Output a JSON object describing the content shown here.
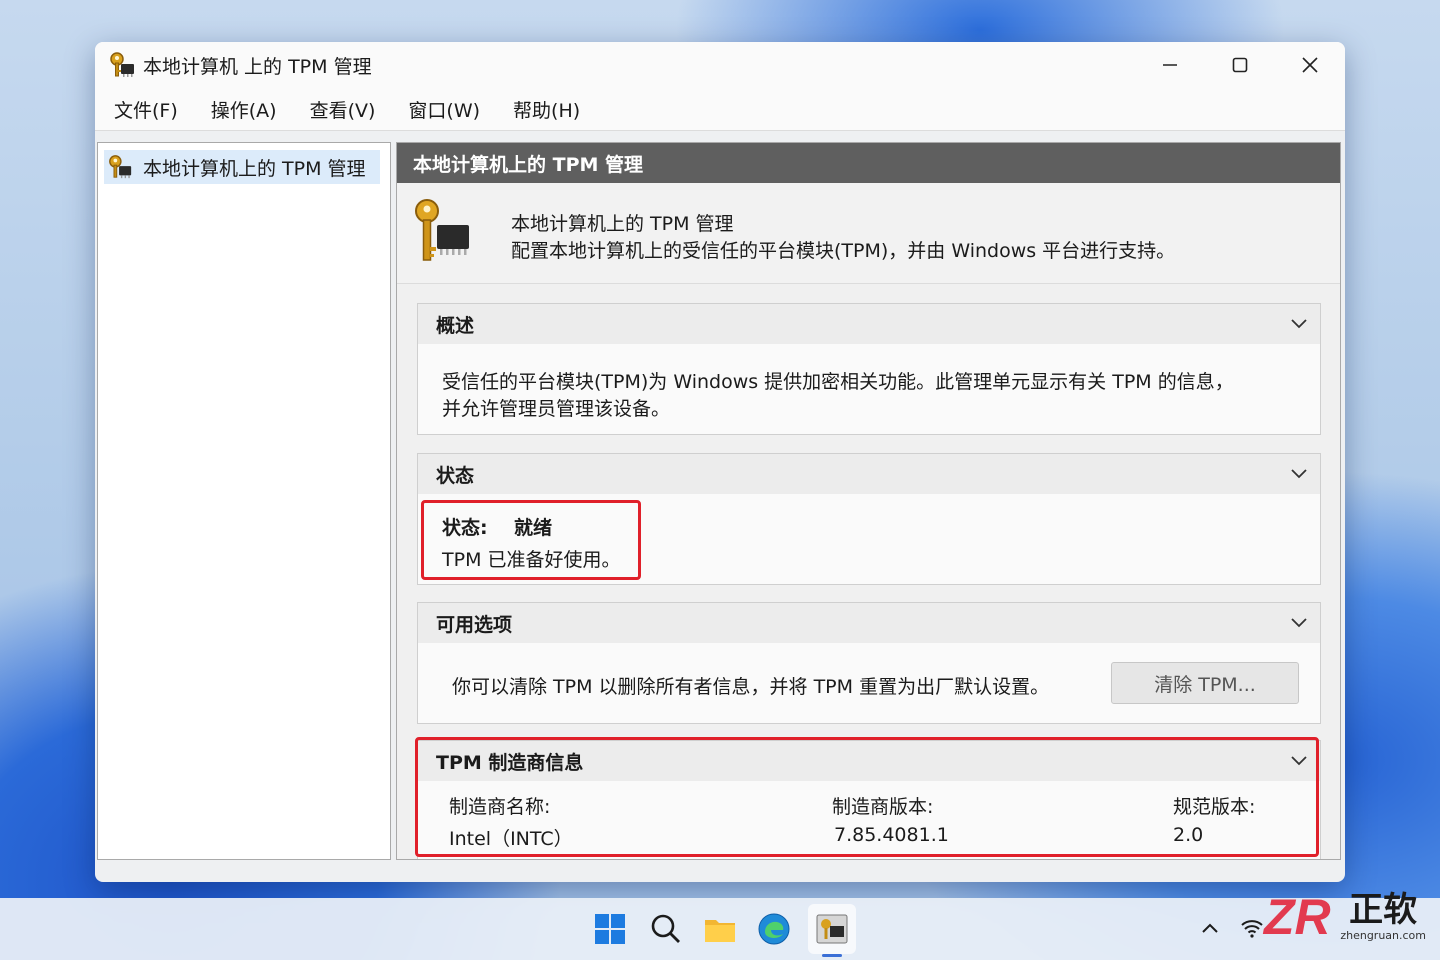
{
  "window": {
    "title": "本地计算机 上的 TPM 管理",
    "controls": {
      "minimize": "minimize-icon",
      "maximize": "maximize-icon",
      "close": "close-icon"
    }
  },
  "menu": [
    "文件(F)",
    "操作(A)",
    "查看(V)",
    "窗口(W)",
    "帮助(H)"
  ],
  "tree": {
    "item_label": "本地计算机上的 TPM 管理",
    "icon": "tpm-key-chip-icon"
  },
  "content": {
    "header": "本地计算机上的 TPM 管理",
    "intro_title": "本地计算机上的 TPM 管理",
    "intro_desc": "配置本地计算机上的受信任的平台模块(TPM)，并由 Windows 平台进行支持。",
    "overview": {
      "title": "概述",
      "line1": "受信任的平台模块(TPM)为 Windows 提供加密相关功能。此管理单元显示有关 TPM 的信息，",
      "line2": "并允许管理员管理该设备。"
    },
    "status": {
      "title": "状态",
      "label": "状态:",
      "value": "就绪",
      "message": "TPM 已准备好使用。"
    },
    "options": {
      "title": "可用选项",
      "text": "你可以清除 TPM 以删除所有者信息，并将 TPM 重置为出厂默认设置。",
      "button": "清除 TPM..."
    },
    "manufacturer": {
      "title": "TPM 制造商信息",
      "name_label": "制造商名称:",
      "name_value": "Intel（INTC）",
      "version_label": "制造商版本:",
      "version_value": "7.85.4081.1",
      "spec_label": "规范版本:",
      "spec_value": "2.0"
    }
  },
  "taskbar": {
    "icons": [
      "windows-start-icon",
      "search-icon",
      "file-explorer-icon",
      "edge-icon",
      "tpm-app-icon"
    ],
    "tray_chevron": "chevron-up-icon"
  },
  "watermark": {
    "logo": "ZR",
    "name": "正软",
    "url": "zhengruan.com"
  },
  "colors": {
    "highlight": "#e0202a",
    "header_bg": "#5f5f5f",
    "tree_select": "#dcebfa"
  }
}
